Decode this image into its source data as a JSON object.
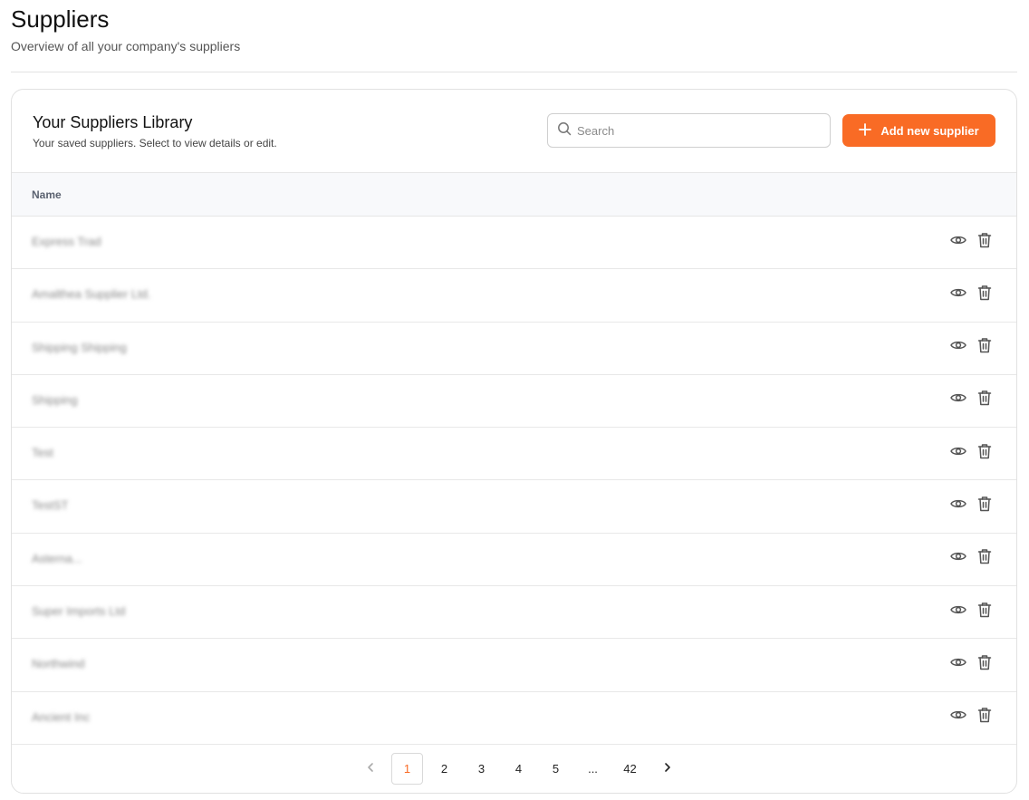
{
  "header": {
    "title": "Suppliers",
    "subtitle": "Overview of all your company's suppliers"
  },
  "library": {
    "title": "Your Suppliers Library",
    "subtitle": "Your saved suppliers. Select to view details or edit.",
    "search_placeholder": "Search",
    "add_label": "Add new supplier"
  },
  "table": {
    "column_name": "Name",
    "rows": [
      {
        "name": "Express Trad"
      },
      {
        "name": "Amalthea Supplier Ltd."
      },
      {
        "name": "Shipping Shipping"
      },
      {
        "name": "Shipping"
      },
      {
        "name": "Test"
      },
      {
        "name": "TestST"
      },
      {
        "name": "Asterna..."
      },
      {
        "name": "Super Imports Ltd"
      },
      {
        "name": "Northwind"
      },
      {
        "name": "Ancient Inc"
      }
    ]
  },
  "pagination": {
    "pages": [
      "1",
      "2",
      "3",
      "4",
      "5",
      "...",
      "42"
    ],
    "current": "1"
  },
  "colors": {
    "accent": "#f96b25",
    "icon": "#555555"
  }
}
